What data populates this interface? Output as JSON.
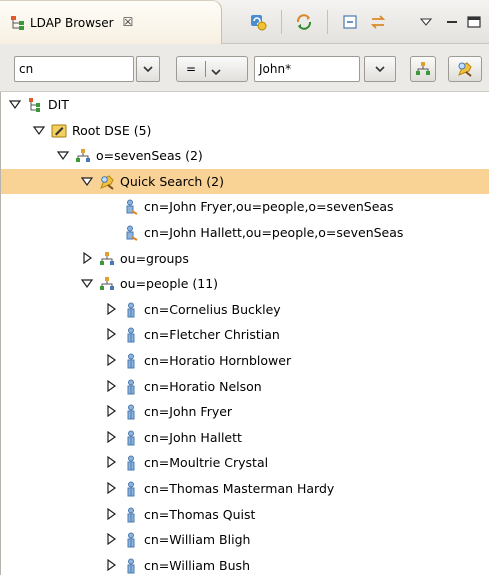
{
  "view": {
    "title": "LDAP Browser",
    "close_glyph": "☒"
  },
  "toolbar": {
    "buttons": [
      {
        "icon": "reload-icon"
      },
      {
        "icon": "link-with-editor-icon"
      },
      {
        "icon": "collapse-all-icon"
      },
      {
        "icon": "sync-icon"
      },
      {
        "icon": "view-menu-icon"
      },
      {
        "icon": "minimize-icon"
      },
      {
        "icon": "maximize-icon"
      }
    ]
  },
  "quick_search": {
    "attribute": "cn",
    "operator": "=",
    "value": "John*"
  },
  "tree": {
    "rows": [
      {
        "label": "DIT",
        "level": 0,
        "twisty": "expanded",
        "icon": "dit-icon"
      },
      {
        "label": "Root DSE (5)",
        "level": 1,
        "twisty": "expanded",
        "icon": "root-dse-icon"
      },
      {
        "label": "o=sevenSeas (2)",
        "level": 2,
        "twisty": "expanded",
        "icon": "entry-tree-icon"
      },
      {
        "label": "Quick Search (2)",
        "level": 3,
        "twisty": "expanded",
        "icon": "quick-search-icon",
        "selected": true
      },
      {
        "label": "cn=John Fryer,ou=people,o=sevenSeas",
        "level": 4,
        "twisty": "none",
        "icon": "search-result-person-icon"
      },
      {
        "label": "cn=John Hallett,ou=people,o=sevenSeas",
        "level": 4,
        "twisty": "none",
        "icon": "search-result-person-icon"
      },
      {
        "label": "ou=groups",
        "level": 3,
        "twisty": "collapsed",
        "icon": "entry-tree-icon"
      },
      {
        "label": "ou=people (11)",
        "level": 3,
        "twisty": "expanded",
        "icon": "entry-tree-icon"
      },
      {
        "label": "cn=Cornelius Buckley",
        "level": 4,
        "twisty": "collapsed",
        "icon": "person-icon"
      },
      {
        "label": "cn=Fletcher Christian",
        "level": 4,
        "twisty": "collapsed",
        "icon": "person-icon"
      },
      {
        "label": "cn=Horatio Hornblower",
        "level": 4,
        "twisty": "collapsed",
        "icon": "person-icon"
      },
      {
        "label": "cn=Horatio Nelson",
        "level": 4,
        "twisty": "collapsed",
        "icon": "person-icon"
      },
      {
        "label": "cn=John Fryer",
        "level": 4,
        "twisty": "collapsed",
        "icon": "person-icon"
      },
      {
        "label": "cn=John Hallett",
        "level": 4,
        "twisty": "collapsed",
        "icon": "person-icon"
      },
      {
        "label": "cn=Moultrie Crystal",
        "level": 4,
        "twisty": "collapsed",
        "icon": "person-icon"
      },
      {
        "label": "cn=Thomas Masterman Hardy",
        "level": 4,
        "twisty": "collapsed",
        "icon": "person-icon"
      },
      {
        "label": "cn=Thomas Quist",
        "level": 4,
        "twisty": "collapsed",
        "icon": "person-icon"
      },
      {
        "label": "cn=William Bligh",
        "level": 4,
        "twisty": "collapsed",
        "icon": "person-icon"
      },
      {
        "label": "cn=William Bush",
        "level": 4,
        "twisty": "collapsed",
        "icon": "person-icon"
      }
    ]
  },
  "colors": {
    "selection": "#f9d295",
    "tab_background": "#fbf6ec"
  }
}
